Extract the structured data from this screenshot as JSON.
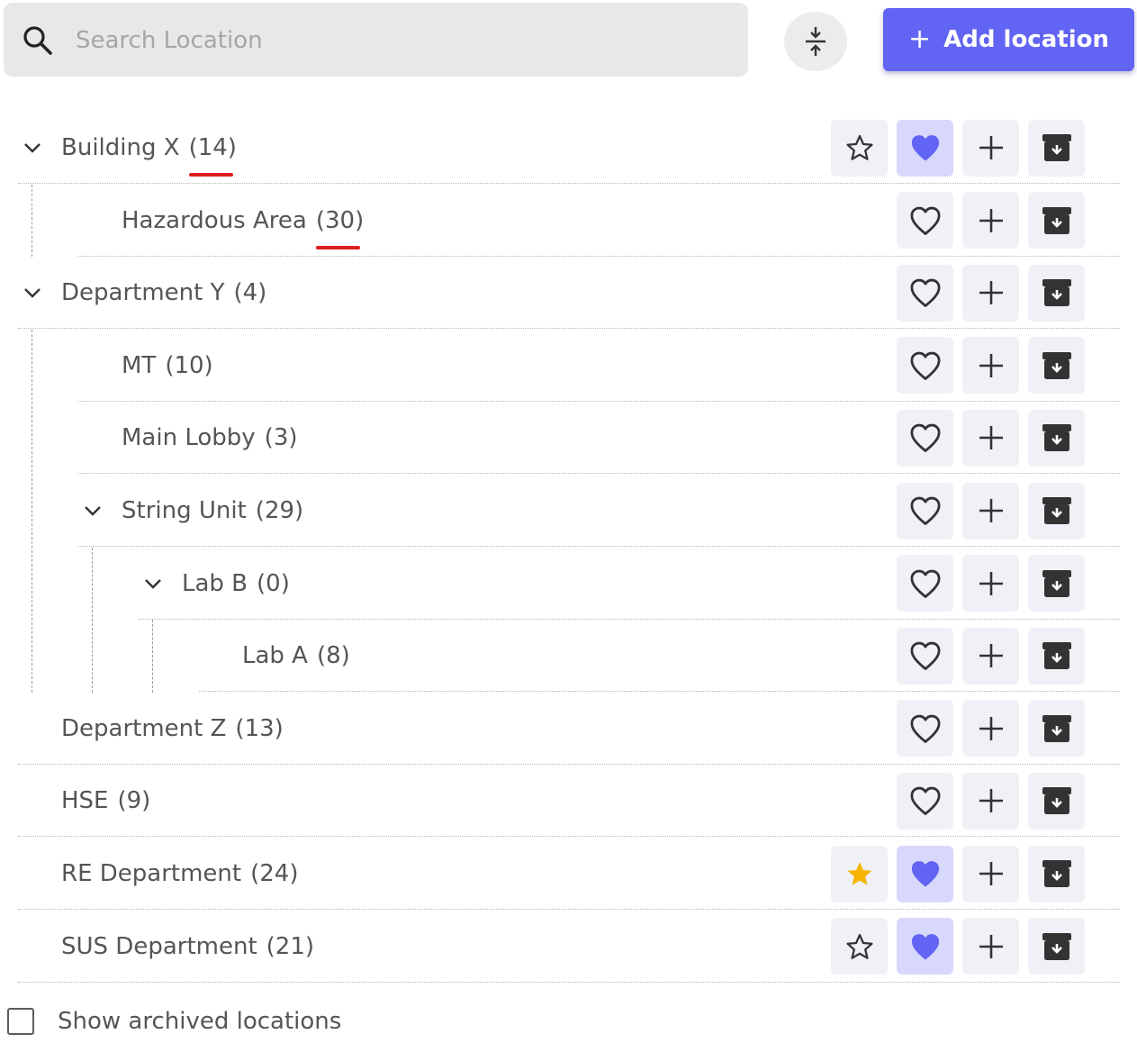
{
  "search": {
    "placeholder": "Search Location",
    "value": ""
  },
  "toolbar": {
    "collapse_icon": "collapse-all-icon",
    "add_label": "Add location",
    "add_icon": "plus-icon"
  },
  "colors": {
    "accent": "#6264f4",
    "favorite_bg": "#d7d8fb",
    "star_active": "#f5b400",
    "annotation_underline": "#e01e1e"
  },
  "tree": [
    {
      "name": "Building X",
      "count": "(14)",
      "depth": 0,
      "expanded": true,
      "starred": false,
      "pinned": true,
      "favorite": true,
      "underline": true
    },
    {
      "name": "Hazardous Area",
      "count": "(30)",
      "depth": 1,
      "expanded": null,
      "starred": false,
      "pinned": false,
      "favorite": false,
      "underline": true
    },
    {
      "name": "Department Y",
      "count": "(4)",
      "depth": 0,
      "expanded": true,
      "starred": false,
      "pinned": false,
      "favorite": false
    },
    {
      "name": "MT",
      "count": "(10)",
      "depth": 1,
      "expanded": null,
      "starred": false,
      "pinned": false,
      "favorite": false
    },
    {
      "name": "Main Lobby",
      "count": "(3)",
      "depth": 1,
      "expanded": null,
      "starred": false,
      "pinned": false,
      "favorite": false
    },
    {
      "name": "String Unit",
      "count": "(29)",
      "depth": 1,
      "expanded": true,
      "starred": false,
      "pinned": false,
      "favorite": false
    },
    {
      "name": "Lab B",
      "count": "(0)",
      "depth": 2,
      "expanded": true,
      "starred": false,
      "pinned": false,
      "favorite": false
    },
    {
      "name": "Lab A",
      "count": "(8)",
      "depth": 3,
      "expanded": null,
      "starred": false,
      "pinned": false,
      "favorite": false
    },
    {
      "name": "Department Z",
      "count": "(13)",
      "depth": 0,
      "expanded": null,
      "starred": false,
      "pinned": false,
      "favorite": false
    },
    {
      "name": "HSE",
      "count": "(9)",
      "depth": 0,
      "expanded": null,
      "starred": false,
      "pinned": false,
      "favorite": false
    },
    {
      "name": "RE Department",
      "count": "(24)",
      "depth": 0,
      "expanded": null,
      "starred": true,
      "pinned": true,
      "favorite": true
    },
    {
      "name": "SUS Department",
      "count": "(21)",
      "depth": 0,
      "expanded": null,
      "starred": false,
      "pinned": true,
      "favorite": true
    }
  ],
  "row_actions": [
    "star-icon",
    "heart-icon",
    "plus-icon",
    "archive-icon"
  ],
  "footer": {
    "show_archived_label": "Show archived locations",
    "checked": false
  }
}
